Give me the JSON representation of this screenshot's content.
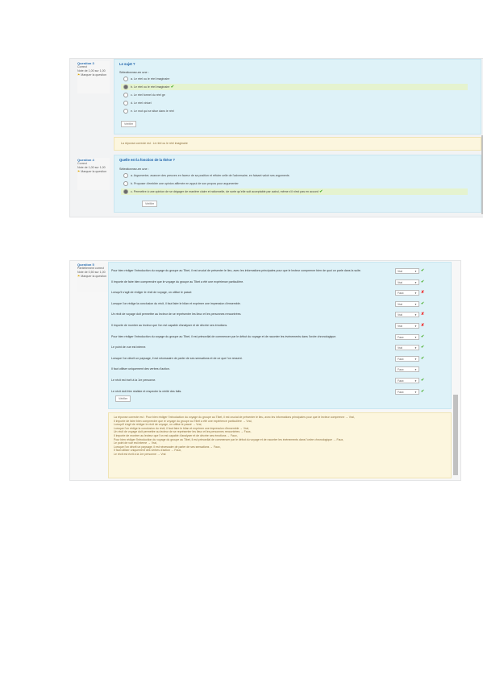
{
  "block1": {
    "q1": {
      "info": [
        "Question 3",
        "Correct",
        "Note de 1,00 sur 1,00",
        "Marquer la question"
      ],
      "title": "Le sujet ?",
      "prompt": "Sélectionnez-en une :",
      "options": [
        {
          "label": "a. Le réel ou le réel imaginaire",
          "selected": false,
          "mark": ""
        },
        {
          "label": "b. Le réel ou le réel imaginaire",
          "selected": true,
          "mark": "tick"
        },
        {
          "label": "c. Le réel formel du réel ge",
          "selected": false,
          "mark": ""
        },
        {
          "label": "d. Le réel virtuel",
          "selected": false,
          "mark": ""
        },
        {
          "label": "e. Le mot qui se situe dans le réel",
          "selected": false,
          "mark": ""
        }
      ],
      "button": "Vérifier"
    },
    "feedback1": "La réponse correcte est : Le réel ou le réel imaginaire",
    "q2": {
      "info": [
        "Question 4",
        "Correct",
        "Note de 1,00 sur 1,00",
        "Marquer la question"
      ],
      "title": "Quelle est la fonction de la thèse ?",
      "prompt": "Sélectionnez-en une :",
      "options": [
        {
          "label": "a. Argumenter, avancer des preuves en faveur de sa position et réfuter celle de l'adversaire, en faisant valoir ses arguments",
          "selected": false,
          "mark": ""
        },
        {
          "label": "b. Proposer d'emblée une opinion affirmée en appui de son propos pour argumenter",
          "selected": false,
          "mark": ""
        },
        {
          "label": "c. Permettre à une opinion de se dégager de manière claire et rationnelle, de sorte qu'elle soit acceptable par autrui, même s'il n'est pas en accord",
          "selected": true,
          "mark": "tick"
        }
      ],
      "button": "Vérifier"
    }
  },
  "block2": {
    "info": [
      "Question 5",
      "Partiellement correct",
      "Note de 0,50 sur 1,00",
      "Marquer la question"
    ],
    "rows": [
      {
        "text": "Pour bien rédiger l'introduction du voyage du groupe au Tibet, il est crucial de présenter le lieu, avec les informations principales pour que le lecteur comprenne bien de quoi on parle dans la suite.",
        "value": "Vrai",
        "mark": "tick"
      },
      {
        "text": "Il importe de faire bien comprendre que le voyage du groupe au Tibet a été une expérience particulière.",
        "value": "Vrai",
        "mark": "tick"
      },
      {
        "text": "Lorsqu'il s'agit de rédiger le récit de voyage, on utilise le passé.",
        "value": "Faux",
        "mark": "cross"
      },
      {
        "text": "Lorsque l'on rédige la conclusion du récit, il faut faire le bilan et exprimer une impression d'ensemble.",
        "value": "Vrai",
        "mark": "tick"
      },
      {
        "text": "Un récit de voyage doit permettre au lecteur de se représenter les lieux et les personnes rencontrées.",
        "value": "Vrai",
        "mark": "cross"
      },
      {
        "text": "Il importe de montrer au lecteur que l'on est capable d'analyser et de décrire ses émotions.",
        "value": "Vrai",
        "mark": "cross"
      },
      {
        "text": "Pour bien rédiger l'introduction du voyage du groupe au Tibet, il est primordial de commencer par le début du voyage et de raconter les événements dans l'ordre chronologique.",
        "value": "Faux",
        "mark": "tick"
      },
      {
        "text": "Le point de vue est interne.",
        "value": "Vrai",
        "mark": "tick"
      },
      {
        "text": "Lorsque l'on décrit un paysage, il est nécessaire de parler de ses sensations et de ce que l'on ressent.",
        "value": "Faux",
        "mark": "tick"
      },
      {
        "text": "Il faut utiliser uniquement des verbes d'action.",
        "value": "Faux",
        "mark": ""
      },
      {
        "text": "Le récit est écrit à la 1re personne.",
        "value": "Faux",
        "mark": "tick"
      },
      {
        "text": "Le récit doit être réaliste et respecter la vérité des faits.",
        "value": "Faux",
        "mark": "tick"
      }
    ],
    "button": "Vérifier",
    "feedback": [
      "La réponse correcte est : Pour bien rédiger l'introduction du voyage du groupe au Tibet, il est crucial de présenter le lieu, avec les informations principales pour que le lecteur comprenne → Vrai,",
      "Il importe de faire bien comprendre que le voyage du groupe au Tibet a été une expérience particulière → Vrai,",
      "Lorsqu'il s'agit de rédiger le récit de voyage, on utilise le passé → Vrai,",
      "Lorsque l'on rédige la conclusion du récit, il faut faire le bilan et exprimer une impression d'ensemble → Vrai,",
      "Un récit de voyage doit permettre au lecteur de se représenter les lieux et les personnes rencontrées → Faux,",
      "Il importe de montrer au lecteur que l'on est capable d'analyser et de décrire ses émotions → Faux,",
      "Pour bien rédiger l'introduction du voyage du groupe au Tibet, il est primordial de commencer par le début du voyage et de raconter les événements dans l'ordre chronologique → Faux,",
      "Le point de vue est interne → Vrai,",
      "Lorsque l'on décrit un paysage, il est nécessaire de parler de ses sensations → Faux,",
      "Il faut utiliser uniquement des verbes d'action → Faux,",
      "Le récit est écrit à la 1re personne → Vrai"
    ]
  }
}
